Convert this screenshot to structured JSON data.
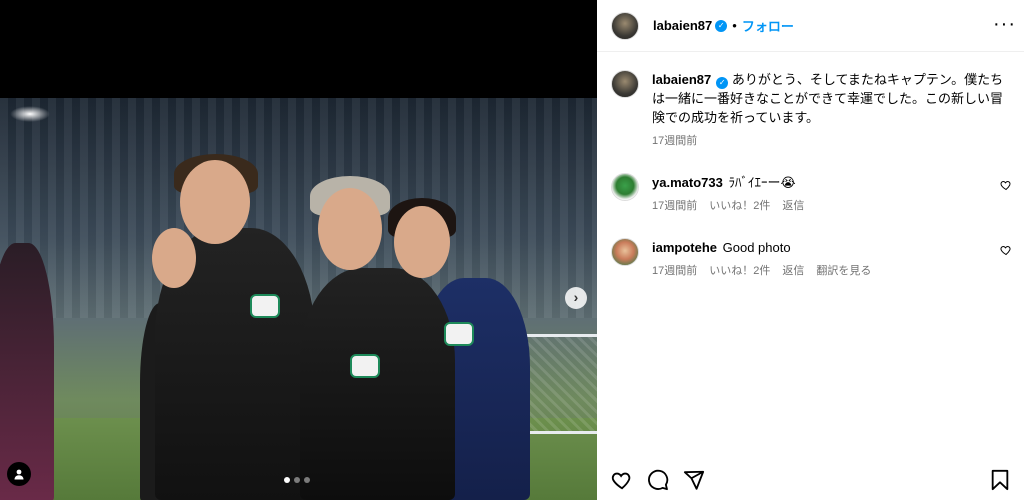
{
  "post": {
    "username": "labaien87",
    "follow_label": "フォロー",
    "separator": "•",
    "caption": {
      "username": "labaien87",
      "text": "ありがとう、そしてまたねキャプテン。僕たちは一緒に一番好きなことができて幸運でした。この新しい冒険での成功を祈っています。",
      "time": "17週間前"
    }
  },
  "comments": [
    {
      "username": "ya.mato733",
      "text": "ﾗﾊﾞｲｴｰー😭",
      "time": "17週間前",
      "likes": "いいね！2件",
      "reply": "返信"
    },
    {
      "username": "iampotehe",
      "text": "Good photo",
      "time": "17週間前",
      "likes": "いいね！2件",
      "reply": "返信",
      "translate": "翻訳を見る"
    }
  ],
  "carousel": {
    "slide_count": 3,
    "current": 1
  },
  "colors": {
    "accent": "#0095f6",
    "meta": "#737373"
  },
  "icons": [
    "heart-icon",
    "comment-icon",
    "share-icon",
    "bookmark-icon",
    "more-icon",
    "next-icon",
    "user-tag-icon",
    "verified-icon"
  ]
}
